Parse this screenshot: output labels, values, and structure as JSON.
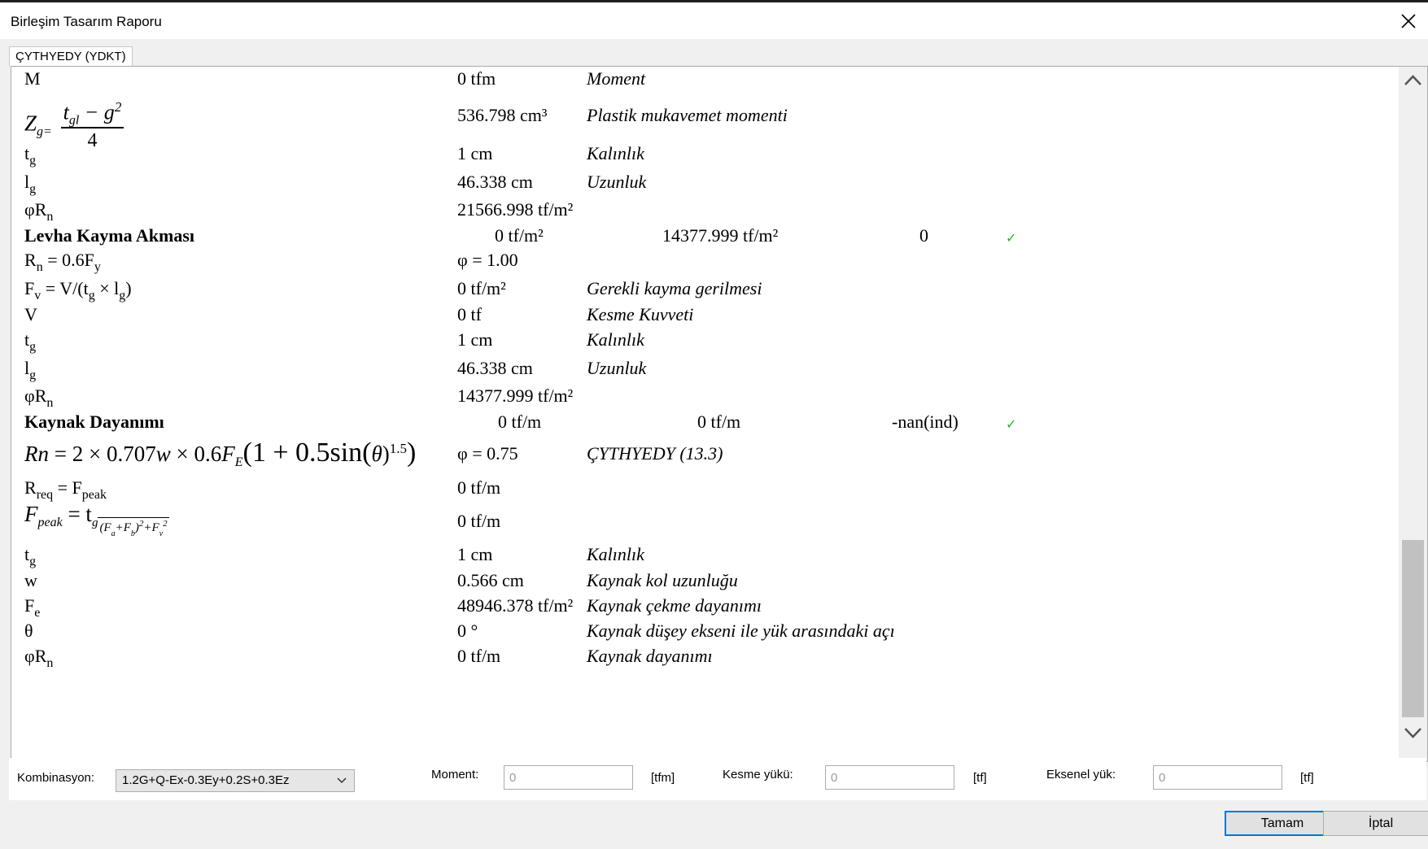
{
  "window": {
    "title": "Birleşim Tasarım Raporu"
  },
  "tab": {
    "label": "ÇYTHYEDY (YDKT)"
  },
  "report": {
    "r1": {
      "label": "M",
      "value": "0 tfm",
      "desc": "Moment"
    },
    "r2": {
      "lbl_z": "Z",
      "lbl_g": "g=",
      "frac_num_t": "t",
      "frac_num_sub": "gl",
      "frac_num_rest": " − g",
      "frac_num_sup": "2",
      "frac_den": "4",
      "value": "536.798 cm³",
      "desc": "Plastik mukavemet momenti"
    },
    "r3": {
      "label": "t",
      "sub": "g",
      "value": "1 cm",
      "desc": "Kalınlık"
    },
    "r4": {
      "label": "l",
      "sub": "g",
      "value": "46.338 cm",
      "desc": "Uzunluk"
    },
    "r5": {
      "label": "φR",
      "sub": "n",
      "value": "21566.998 tf/m²"
    },
    "h1": {
      "label": "Levha Kayma Akması",
      "c1": "0 tf/m²",
      "c2": "14377.999 tf/m²",
      "c3": "0",
      "check": "✓"
    },
    "r6": {
      "label": "R",
      "sub": "n",
      "rest": " = 0.6F",
      "sub2": "y",
      "value": "φ = 1.00"
    },
    "r7": {
      "label": "F",
      "sub": "v",
      "rest1": " = V/(t",
      "sub2": "g",
      "rest2": " × l",
      "sub3": "g",
      "rest3": ")",
      "value": "0 tf/m²",
      "desc": "Gerekli kayma gerilmesi"
    },
    "r8": {
      "label": "V",
      "value": "0 tf",
      "desc": "Kesme Kuvveti"
    },
    "r9": {
      "label": "t",
      "sub": "g",
      "value": "1 cm",
      "desc": "Kalınlık"
    },
    "r10": {
      "label": "l",
      "sub": "g",
      "value": "46.338 cm",
      "desc": "Uzunluk"
    },
    "r11": {
      "label": "φR",
      "sub": "n",
      "value": "14377.999 tf/m²"
    },
    "h2": {
      "label": "Kaynak Dayanımı",
      "c1": "0 tf/m",
      "c2": "0 tf/m",
      "c3": "-nan(ind)",
      "check": "✓"
    },
    "r12": {
      "formula_a": "Rn",
      "formula_b": " = 2 × 0.707",
      "formula_w": "w",
      "formula_c": " × 0.6",
      "formula_f": "F",
      "formula_fsub": "E",
      "formula_d": "(1 + 0.5sin(",
      "formula_theta": "θ",
      "formula_e": ")",
      "formula_sup": "1.5",
      "formula_end": ")",
      "value": "φ = 0.75",
      "desc": "ÇYTHYEDY (13.3)"
    },
    "r13": {
      "label": "R",
      "sub": "req",
      "rest": " = F",
      "sub2": "peak",
      "value": "0 tf/m"
    },
    "r14": {
      "lhs": "F",
      "lhs_sub": "peak",
      "eq": " = t",
      "g": "g",
      "root": "(F",
      "a": "a",
      "plus": "+F",
      "b": "b",
      "close": ")",
      "sq": "2",
      "plus2": "+F",
      "v": "v",
      "sq2": "2",
      "value": "0 tf/m"
    },
    "r15": {
      "label": "t",
      "sub": "g",
      "value": "1 cm",
      "desc": "Kalınlık"
    },
    "r16": {
      "label": "w",
      "value": "0.566 cm",
      "desc": "Kaynak kol uzunluğu"
    },
    "r17": {
      "label": "F",
      "sub": "e",
      "value": "48946.378 tf/m²",
      "desc": "Kaynak çekme dayanımı"
    },
    "r18": {
      "label": "θ",
      "value": "0 °",
      "desc": "Kaynak düşey ekseni ile yük arasındaki açı"
    },
    "r19": {
      "label": "φR",
      "sub": "n",
      "value": "0 tf/m",
      "desc": "Kaynak dayanımı"
    }
  },
  "controls": {
    "kombinasyon_label": "Kombinasyon:",
    "kombinasyon_value": "1.2G+Q-Ex-0.3Ey+0.2S+0.3Ez",
    "moment_label": "Moment:",
    "moment_value": "0",
    "moment_unit": "[tfm]",
    "kesme_label": "Kesme yükü:",
    "kesme_value": "0",
    "kesme_unit": "[tf]",
    "eksenel_label": "Eksenel yük:",
    "eksenel_value": "0",
    "eksenel_unit": "[tf]"
  },
  "buttons": {
    "ok": "Tamam",
    "cancel": "İptal"
  },
  "colors": {
    "check": "#1fb51f",
    "accent": "#0078d7"
  },
  "icons": {
    "close": "close-icon",
    "scroll_up": "chevron-up-icon",
    "scroll_down": "chevron-down-icon",
    "dropdown": "chevron-down-icon",
    "check": "check-icon"
  }
}
